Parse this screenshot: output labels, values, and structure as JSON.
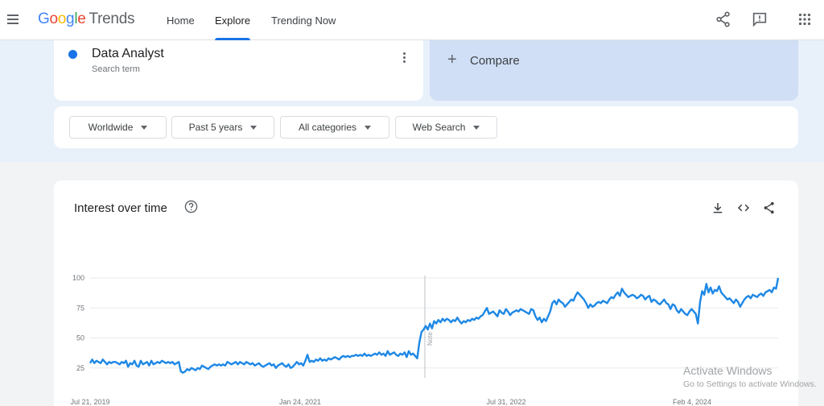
{
  "header": {
    "logo_google": "Google",
    "logo_trends": "Trends",
    "nav": [
      {
        "label": "Home"
      },
      {
        "label": "Explore",
        "active": true
      },
      {
        "label": "Trending Now"
      }
    ],
    "icons": [
      "share-icon",
      "feedback-icon",
      "apps-grid-icon"
    ]
  },
  "search_term": {
    "name": "Data Analyst",
    "type": "Search term",
    "color": "#1a73e8"
  },
  "compare": {
    "label": "Compare"
  },
  "filters": [
    {
      "label": "Worldwide"
    },
    {
      "label": "Past 5 years"
    },
    {
      "label": "All categories"
    },
    {
      "label": "Web Search"
    }
  ],
  "interest_card": {
    "title": "Interest over time",
    "icons": [
      "help-icon",
      "download-icon",
      "embed-icon",
      "share-icon"
    ]
  },
  "chart_data": {
    "type": "line",
    "title": "Interest over time",
    "x_ticks": [
      "Jul 21, 2019",
      "Jan 24, 2021",
      "Jul 31, 2022",
      "Feb 4, 2024"
    ],
    "y_ticks": [
      25,
      50,
      75,
      100
    ],
    "ylim": [
      0,
      100
    ],
    "grid": true,
    "annotation": "Note",
    "series": [
      {
        "color": "#1e88e5",
        "values": [
          29,
          32,
          29,
          31,
          30,
          29,
          32,
          30,
          28,
          30,
          29,
          30,
          30,
          29,
          28,
          30,
          29,
          31,
          26,
          29,
          28,
          31,
          27,
          26,
          31,
          28,
          29,
          30,
          27,
          31,
          28,
          29,
          30,
          29,
          31,
          30,
          29,
          30,
          29,
          30,
          28,
          29,
          30,
          22,
          21,
          22,
          24,
          23,
          25,
          24,
          23,
          25,
          24,
          27,
          26,
          25,
          24,
          26,
          27,
          28,
          27,
          28,
          27,
          28,
          27,
          30,
          29,
          28,
          29,
          30,
          28,
          30,
          29,
          28,
          30,
          29,
          28,
          29,
          27,
          28,
          29,
          27,
          26,
          27,
          28,
          29,
          27,
          28,
          25,
          27,
          28,
          29,
          27,
          26,
          28,
          25,
          26,
          28,
          30,
          28,
          29,
          27,
          31,
          36,
          30,
          31,
          30,
          32,
          31,
          33,
          31,
          32,
          31,
          33,
          32,
          33,
          34,
          33,
          32,
          34,
          35,
          34,
          35,
          34,
          35,
          35,
          36,
          35,
          36,
          35,
          37,
          35,
          36,
          35,
          36,
          37,
          36,
          38,
          36,
          37,
          35,
          39,
          36,
          37,
          38,
          36,
          35,
          37,
          36,
          38,
          34,
          39,
          36,
          37,
          35,
          33,
          46,
          55,
          57,
          60,
          57,
          62,
          58,
          64,
          62,
          65,
          63,
          66,
          64,
          66,
          65,
          63,
          65,
          64,
          67,
          64,
          62,
          64,
          63,
          65,
          64,
          66,
          65,
          67,
          66,
          68,
          69,
          72,
          75,
          70,
          71,
          72,
          70,
          68,
          73,
          71,
          70,
          74,
          72,
          69,
          71,
          72,
          73,
          72,
          74,
          73,
          72,
          71,
          70,
          74,
          73,
          68,
          65,
          67,
          63,
          66,
          64,
          68,
          72,
          79,
          81,
          78,
          82,
          80,
          79,
          76,
          78,
          80,
          82,
          81,
          85,
          88,
          86,
          84,
          82,
          79,
          75,
          78,
          76,
          77,
          79,
          80,
          79,
          81,
          80,
          79,
          82,
          84,
          83,
          86,
          88,
          85,
          91,
          88,
          86,
          84,
          85,
          86,
          85,
          83,
          84,
          86,
          85,
          82,
          84,
          85,
          80,
          82,
          81,
          79,
          78,
          80,
          82,
          79,
          78,
          74,
          78,
          77,
          73,
          71,
          74,
          72,
          70,
          69,
          72,
          74,
          72,
          70,
          62,
          80,
          89,
          86,
          95,
          88,
          92,
          87,
          90,
          89,
          93,
          88,
          86,
          84,
          82,
          83,
          81,
          79,
          82,
          80,
          76,
          79,
          82,
          84,
          85,
          83,
          86,
          85,
          84,
          86,
          87,
          85,
          88,
          89,
          90,
          88,
          92,
          91,
          100
        ]
      }
    ]
  }
}
